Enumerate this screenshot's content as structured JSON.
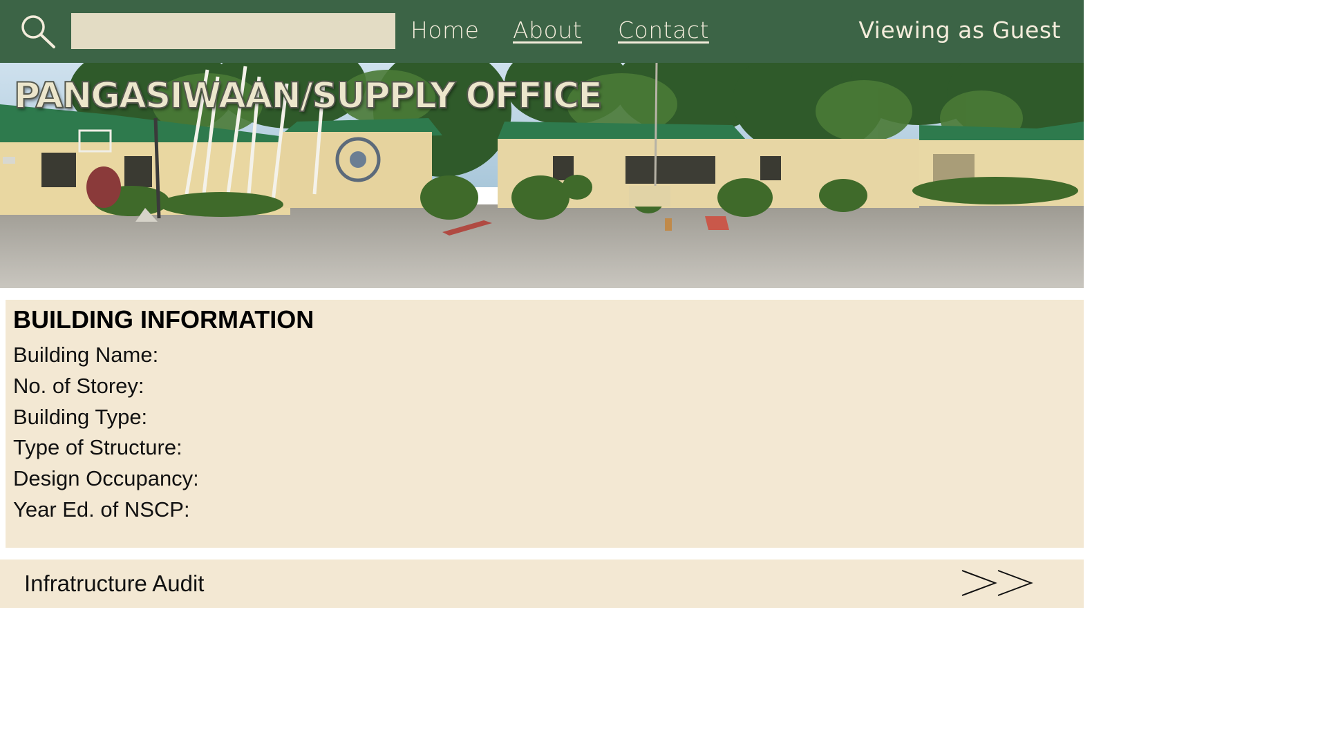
{
  "navbar": {
    "search": {
      "icon": "search-icon",
      "value": "",
      "placeholder": ""
    },
    "links": [
      {
        "label": "Home"
      },
      {
        "label": "About"
      },
      {
        "label": "Contact"
      }
    ],
    "user_status": "Viewing as Guest"
  },
  "hero": {
    "title": "PANGASIWAAN/SUPPLY OFFICE"
  },
  "building_info": {
    "heading": "BUILDING INFORMATION",
    "fields": [
      {
        "label": "Building Name:"
      },
      {
        "label": "No. of Storey:"
      },
      {
        "label": "Building Type:"
      },
      {
        "label": "Type of Structure:"
      },
      {
        "label": "Design Occupancy:"
      },
      {
        "label": "Year Ed. of NSCP:"
      }
    ]
  },
  "footer_nav": {
    "label": "Infratructure Audit",
    "icon": "double-chevron-right-icon"
  },
  "colors": {
    "navbar": "#3c6446",
    "search_field": "#e3dcc4",
    "panel": "#f3e8d3",
    "nav_text": "#f3ecdb",
    "roof_green": "#2f7a4d"
  }
}
